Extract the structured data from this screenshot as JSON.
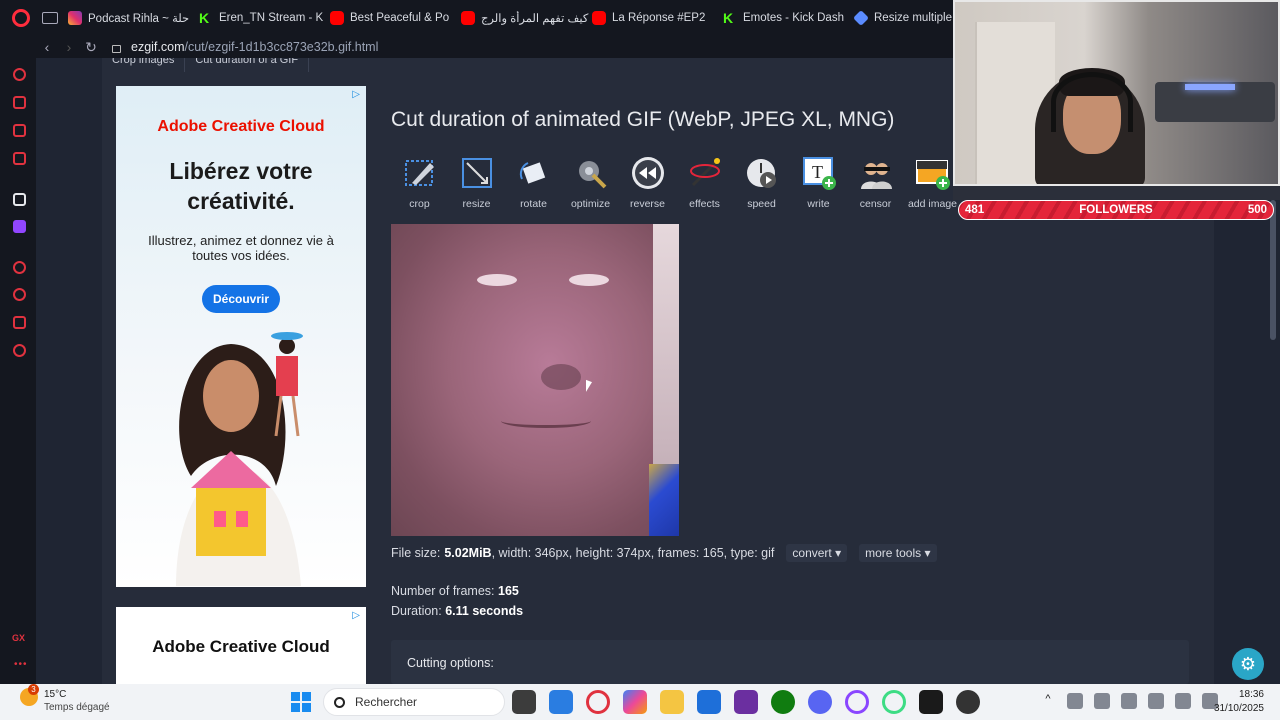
{
  "bookmarks": [
    {
      "label": "Podcast Rihla ~ حلة",
      "favicon": "instagram-icon"
    },
    {
      "label": "Eren_TN Stream - K",
      "favicon": "kick-icon"
    },
    {
      "label": "Best Peaceful & Po",
      "favicon": "youtube-icon"
    },
    {
      "label": "كيف تفهم المرأة والرج",
      "favicon": "youtube-icon"
    },
    {
      "label": "La Réponse #EP2",
      "favicon": "youtube-icon"
    },
    {
      "label": "Emotes - Kick Dash",
      "favicon": "kick-icon"
    },
    {
      "label": "Resize multiple im",
      "favicon": "diamond-icon"
    }
  ],
  "address": {
    "domain": "ezgif.com",
    "path": "/cut/ezgif-1d1b3cc873e32b.gif.html"
  },
  "tabs": [
    "Crop images",
    "Cut duration of a GIF"
  ],
  "ad1": {
    "badge": "▷",
    "logo": "Adobe Creative Cloud",
    "headline": "Libérez votre créativité.",
    "subtext": "Illustrez, animez et donnez vie à toutes vos idées.",
    "button": "Découvrir"
  },
  "ad2": {
    "badge": "▷",
    "logo": "Adobe Creative Cloud"
  },
  "page": {
    "title": "Cut duration of animated GIF (WebP, JPEG XL, MNG)",
    "tools": [
      {
        "label": "crop",
        "icon": "crop-icon"
      },
      {
        "label": "resize",
        "icon": "resize-icon"
      },
      {
        "label": "rotate",
        "icon": "rotate-icon"
      },
      {
        "label": "optimize",
        "icon": "optimize-icon"
      },
      {
        "label": "reverse",
        "icon": "reverse-icon"
      },
      {
        "label": "effects",
        "icon": "effects-icon"
      },
      {
        "label": "speed",
        "icon": "speed-icon"
      },
      {
        "label": "write",
        "icon": "write-icon"
      },
      {
        "label": "censor",
        "icon": "censor-icon"
      },
      {
        "label": "add image",
        "icon": "add-image-icon"
      }
    ],
    "file_info": {
      "prefix": "File size:",
      "size": "5.02MiB",
      "rest": ", width: 346px, height: 374px, frames: 165, type: gif",
      "convert": "convert ▾",
      "more_tools": "more tools ▾"
    },
    "frames_label": "Number of frames:",
    "frames_value": "165",
    "duration_label": "Duration:",
    "duration_value": "6.11 seconds",
    "cutting_options": "Cutting options:"
  },
  "stream_overlay": {
    "current": "481",
    "label": "FOLLOWERS",
    "goal": "500"
  },
  "taskbar": {
    "weather_temp": "15°C",
    "weather_desc": "Temps dégagé",
    "weather_badge": "3",
    "search_placeholder": "Rechercher",
    "time": "18:36",
    "date": "31/10/2025"
  },
  "colors": {
    "accent": "#e0323f",
    "page_bg": "#262c3a",
    "adobe_red": "#eb1000",
    "button_blue": "#1473e6"
  }
}
